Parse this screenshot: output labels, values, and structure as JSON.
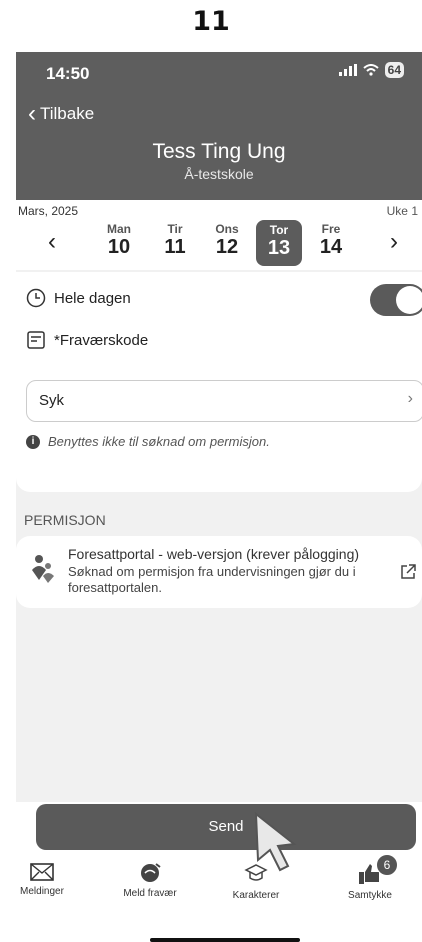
{
  "step_number": "11",
  "status_bar": {
    "time": "14:50",
    "battery": "64"
  },
  "header": {
    "back_label": "Tilbake",
    "student_name": "Tess Ting Ung",
    "school_name": "Å-testskole"
  },
  "calendar": {
    "month": "Mars, 2025",
    "week": "Uke 1",
    "days": [
      {
        "name": "Man",
        "date": "10"
      },
      {
        "name": "Tir",
        "date": "11"
      },
      {
        "name": "Ons",
        "date": "12"
      },
      {
        "name": "Tor",
        "date": "13"
      },
      {
        "name": "Fre",
        "date": "14"
      }
    ],
    "selected": "Tor"
  },
  "form": {
    "all_day_label": "Hele dagen",
    "all_day_on": true,
    "absence_code_label": "*Fraværskode",
    "absence_code_value": "Syk",
    "info_text": "Benyttes ikke til søknad om permisjon."
  },
  "permission": {
    "section_title": "PERMISJON",
    "card_title": "Foresattportal - web-versjon (krever pålogging)",
    "card_desc": "Søknad om permisjon fra undervisningen gjør du i foresattportalen."
  },
  "send_button": "Send",
  "tabs": [
    {
      "label": "Meldinger",
      "icon": "envelope-icon"
    },
    {
      "label": "Meld fravær",
      "icon": "report-absence-icon"
    },
    {
      "label": "Karakterer",
      "icon": "graduation-cap-icon"
    },
    {
      "label": "Samtykke",
      "icon": "thumbs-up-icon",
      "badge": "6"
    }
  ]
}
